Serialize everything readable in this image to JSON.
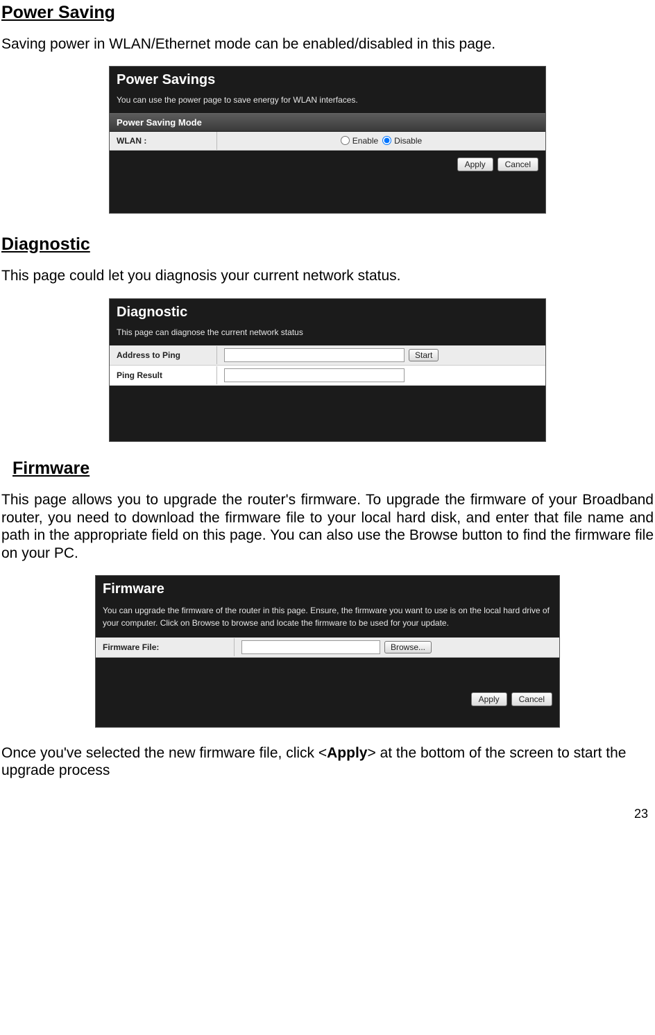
{
  "sections": {
    "power_saving": {
      "title": "Power Saving",
      "intro": " Saving power in WLAN/Ethernet mode can be enabled/disabled in this page."
    },
    "diagnostic": {
      "title": "Diagnostic",
      "intro": "This page could let you diagnosis your current network status."
    },
    "firmware": {
      "title": "Firmware",
      "intro": "This page allows you to upgrade the router's firmware. To upgrade the firmware of your Broadband router, you need to download the firmware file to your local hard disk, and enter that file name and path in the appropriate field on this page. You can also use the Browse button to find the firmware file on your PC.",
      "outro_pre": "Once you've selected the new firmware file, click <",
      "outro_bold": "Apply",
      "outro_post": "> at the bottom of the screen to start the upgrade process"
    }
  },
  "panels": {
    "power_savings": {
      "title": "Power Savings",
      "desc": "You can use the power page to save energy for WLAN interfaces.",
      "subbar": "Power Saving Mode",
      "row_label": "WLAN :",
      "enable_label": "Enable",
      "disable_label": "Disable",
      "apply": "Apply",
      "cancel": "Cancel"
    },
    "diagnostic": {
      "title": "Diagnostic",
      "desc": "This page can diagnose the current network status",
      "addr_label": "Address to Ping",
      "start": "Start",
      "result_label": "Ping Result"
    },
    "firmware": {
      "title": "Firmware",
      "desc": "You can upgrade the firmware of the router in this page. Ensure, the firmware you want to use is on the local hard drive of your computer. Click on Browse to browse and locate the firmware to be used for your update.",
      "file_label": "Firmware File:",
      "browse": "Browse...",
      "apply": "Apply",
      "cancel": "Cancel"
    }
  },
  "page_number": "23"
}
